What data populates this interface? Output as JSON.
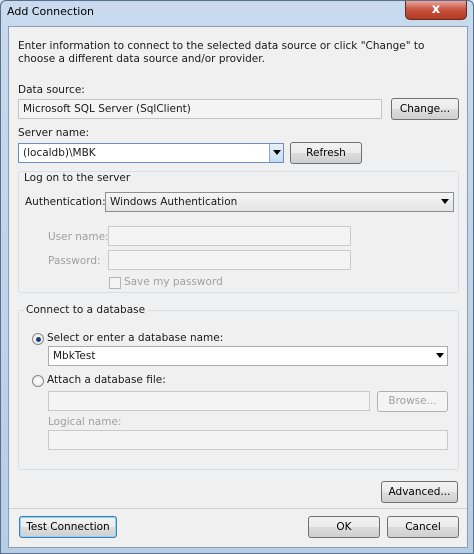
{
  "window": {
    "title": "Add Connection",
    "close_glyph": "x"
  },
  "intro": "Enter information to connect to the selected data source or click \"Change\" to choose a different data source and/or provider.",
  "data_source": {
    "label": "Data source:",
    "value": "Microsoft SQL Server (SqlClient)",
    "change_label": "Change..."
  },
  "server": {
    "label": "Server name:",
    "value": "(localdb)\\MBK",
    "refresh_label": "Refresh"
  },
  "logon": {
    "group_label": "Log on to the server",
    "auth_label": "Authentication:",
    "auth_value": "Windows Authentication",
    "user_label": "User name:",
    "user_value": "",
    "password_label": "Password:",
    "password_value": "",
    "save_password_label": "Save my password",
    "save_password_checked": false
  },
  "database": {
    "group_label": "Connect to a database",
    "select_label": "Select or enter a database name:",
    "select_checked": true,
    "db_value": "MbkTest",
    "attach_label": "Attach a database file:",
    "attach_checked": false,
    "attach_value": "",
    "browse_label": "Browse...",
    "logical_label": "Logical name:",
    "logical_value": ""
  },
  "buttons": {
    "advanced": "Advanced...",
    "test_connection": "Test Connection",
    "ok": "OK",
    "cancel": "Cancel"
  }
}
